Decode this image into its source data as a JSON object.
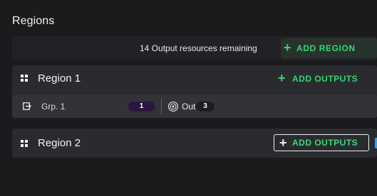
{
  "panel": {
    "title": "Regions",
    "resources_remaining": "14 Output resources remaining",
    "add_region_label": "ADD REGION",
    "plus_glyph": "+"
  },
  "regions": [
    {
      "name": "Region 1",
      "add_outputs_label": "ADD OUTPUTS",
      "groups": [
        {
          "name": "Grp. 1",
          "count": "1",
          "output_label": "Out",
          "output_count": "3"
        }
      ]
    },
    {
      "name": "Region 2",
      "add_outputs_label": "ADD OUTPUTS"
    }
  ],
  "icons": {
    "region": "grid-icon",
    "group": "group-icon",
    "output": "output-icon"
  },
  "colors": {
    "background": "#1b1b1d",
    "card": "#2a2b2f",
    "row": "#323338",
    "accent_green": "#36d476",
    "count_pill": "#2a1640",
    "focus_blue": "#24a8ff"
  }
}
